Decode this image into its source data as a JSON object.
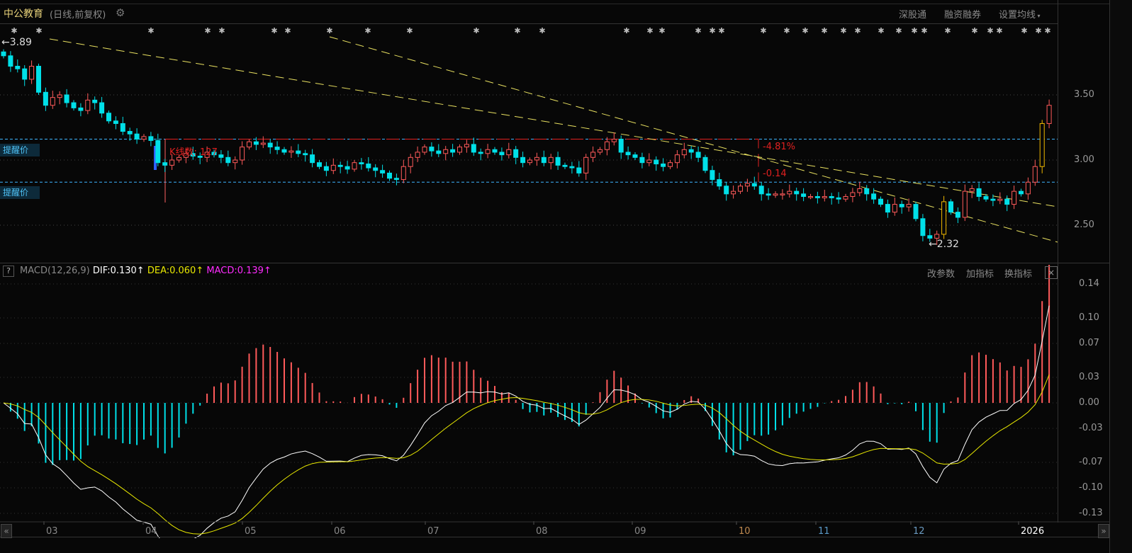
{
  "header": {
    "title": "中公教育",
    "subtitle": "(日线,前复权)",
    "buttons": [
      "深股通",
      "融资融券",
      "设置均线"
    ]
  },
  "price_axis": {
    "ticks": [
      "3.50",
      "3.00",
      "2.50"
    ]
  },
  "annotations": {
    "high_label": "3.89",
    "low_label": "2.32",
    "reminder_label": "提醒价",
    "reminder_prices": [
      3.16,
      2.83
    ],
    "kline_count": "K线数: 127",
    "pct_change": "-4.81%",
    "abs_change": "-0.14"
  },
  "macd": {
    "name": "MACD(12,26,9)",
    "dif": "DIF:0.130",
    "dea": "DEA:0.060",
    "macd": "MACD:0.139",
    "buttons": [
      "改参数",
      "加指标",
      "换指标"
    ],
    "help": "?",
    "close": "×",
    "ticks": [
      "0.14",
      "0.10",
      "0.07",
      "0.03",
      "0.00",
      "-0.03",
      "-0.07",
      "-0.10",
      "-0.13"
    ]
  },
  "months": [
    "03",
    "04",
    "05",
    "06",
    "07",
    "08",
    "09",
    "10",
    "11",
    "12",
    "2026"
  ],
  "nav": {
    "left": "«",
    "right": "»"
  },
  "colors": {
    "up": "#ff5a5a",
    "down": "#00e0e8",
    "dif": "#ffffff",
    "dea": "#e8e800",
    "macd": "#ff2bff",
    "highlight": "#f0b800",
    "reminder": "#3fb6ff"
  },
  "chart_data": {
    "type": "candlestick",
    "title": "中公教育 (日线,前复权)",
    "ylim": [
      2.2,
      3.95
    ],
    "highlight_indices": [
      134,
      148
    ],
    "closes": [
      3.8,
      3.72,
      3.7,
      3.62,
      3.72,
      3.52,
      3.42,
      3.48,
      3.5,
      3.44,
      3.4,
      3.38,
      3.46,
      3.44,
      3.36,
      3.3,
      3.28,
      3.22,
      3.2,
      3.16,
      3.18,
      3.15,
      2.98,
      2.96,
      3.0,
      3.02,
      3.05,
      3.03,
      3.02,
      3.06,
      3.04,
      3.02,
      2.98,
      3.0,
      3.1,
      3.14,
      3.12,
      3.13,
      3.1,
      3.08,
      3.06,
      3.07,
      3.05,
      3.04,
      2.98,
      2.95,
      2.92,
      2.96,
      2.95,
      2.93,
      2.98,
      2.97,
      2.94,
      2.92,
      2.9,
      2.86,
      2.85,
      2.95,
      3.02,
      3.06,
      3.1,
      3.07,
      3.05,
      3.08,
      3.06,
      3.1,
      3.12,
      3.06,
      3.05,
      3.08,
      3.06,
      3.04,
      3.08,
      3.02,
      2.98,
      3.0,
      3.02,
      2.98,
      3.02,
      2.96,
      2.95,
      2.94,
      2.9,
      3.02,
      3.06,
      3.08,
      3.14,
      3.16,
      3.06,
      3.04,
      3.02,
      2.98,
      3.0,
      2.97,
      2.95,
      2.98,
      3.04,
      3.08,
      3.06,
      3.02,
      2.92,
      2.85,
      2.8,
      2.74,
      2.76,
      2.8,
      2.82,
      2.8,
      2.74,
      2.73,
      2.74,
      2.74,
      2.76,
      2.74,
      2.72,
      2.72,
      2.71,
      2.72,
      2.71,
      2.7,
      2.72,
      2.75,
      2.78,
      2.74,
      2.7,
      2.66,
      2.6,
      2.66,
      2.64,
      2.66,
      2.55,
      2.42,
      2.4,
      2.43,
      2.68,
      2.6,
      2.56,
      2.76,
      2.78,
      2.72,
      2.7,
      2.69,
      2.7,
      2.66,
      2.76,
      2.74,
      2.83,
      2.95,
      3.28,
      3.42
    ],
    "macd_params": [
      12,
      26,
      9
    ],
    "macd_ylim": [
      -0.13,
      0.14
    ]
  }
}
